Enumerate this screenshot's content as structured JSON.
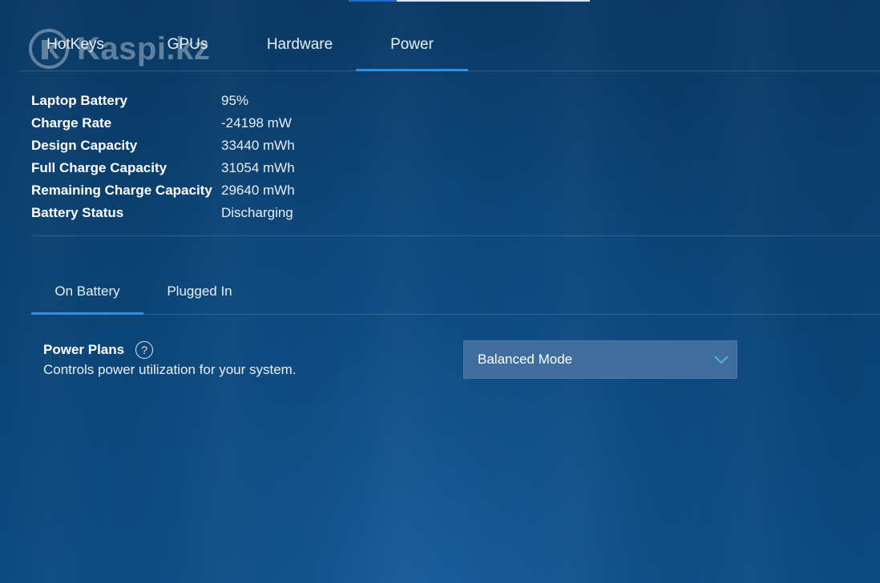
{
  "watermark": {
    "text": "Kaspi.kz"
  },
  "top_tabs": [
    {
      "label": "HotKeys",
      "active": false
    },
    {
      "label": "GPUs",
      "active": false
    },
    {
      "label": "Hardware",
      "active": false
    },
    {
      "label": "Power",
      "active": true
    }
  ],
  "battery_info": [
    {
      "label": "Laptop Battery",
      "value": "95%"
    },
    {
      "label": "Charge Rate",
      "value": "-24198 mW"
    },
    {
      "label": "Design Capacity",
      "value": "33440 mWh"
    },
    {
      "label": "Full Charge Capacity",
      "value": "31054 mWh"
    },
    {
      "label": "Remaining Charge Capacity",
      "value": "29640 mWh"
    },
    {
      "label": "Battery Status",
      "value": "Discharging"
    }
  ],
  "sub_tabs": [
    {
      "label": "On Battery",
      "active": true
    },
    {
      "label": "Plugged In",
      "active": false
    }
  ],
  "power_plans": {
    "title": "Power Plans",
    "help_icon": "?",
    "description": "Controls power utilization for your system.",
    "selected": "Balanced Mode"
  },
  "colors": {
    "accent": "#2f8fe3",
    "background": "#0b4272",
    "dropdown": "#3f6e9c"
  },
  "icons": {
    "help": "help-icon",
    "dropdown": "chevron-down-icon"
  }
}
